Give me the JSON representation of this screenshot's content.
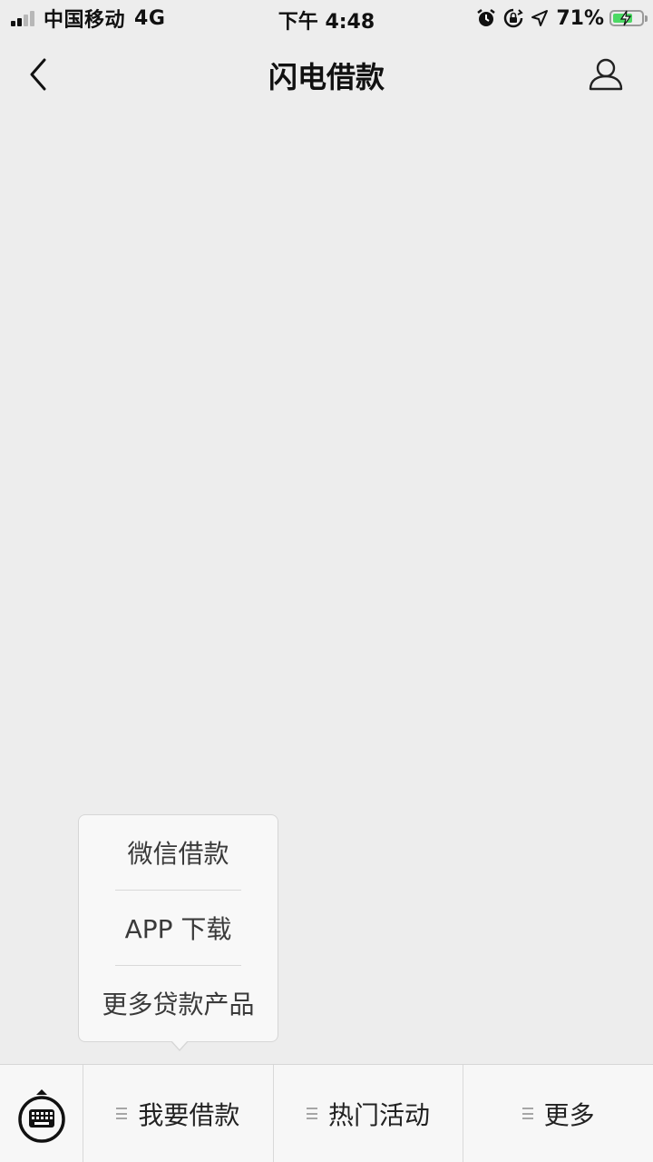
{
  "status_bar": {
    "carrier": "中国移动",
    "network": "4G",
    "time": "下午 4:48",
    "battery_percent": "71%",
    "battery_level": 0.71,
    "battery_color": "#4cd964",
    "icons": [
      "signal-icon",
      "alarm-icon",
      "rotation-lock-icon",
      "location-icon",
      "battery-icon",
      "charging-bolt-icon"
    ]
  },
  "nav": {
    "title": "闪电借款",
    "back_icon": "chevron-left-icon",
    "profile_icon": "user-profile-icon"
  },
  "popup_menu": {
    "items": [
      {
        "label": "微信借款"
      },
      {
        "label": "APP 下载"
      },
      {
        "label": "更多贷款产品"
      }
    ]
  },
  "bottom_menu": {
    "keyboard_icon": "keyboard-icon",
    "items": [
      {
        "label": "我要借款"
      },
      {
        "label": "热门活动"
      },
      {
        "label": "更多"
      }
    ]
  }
}
